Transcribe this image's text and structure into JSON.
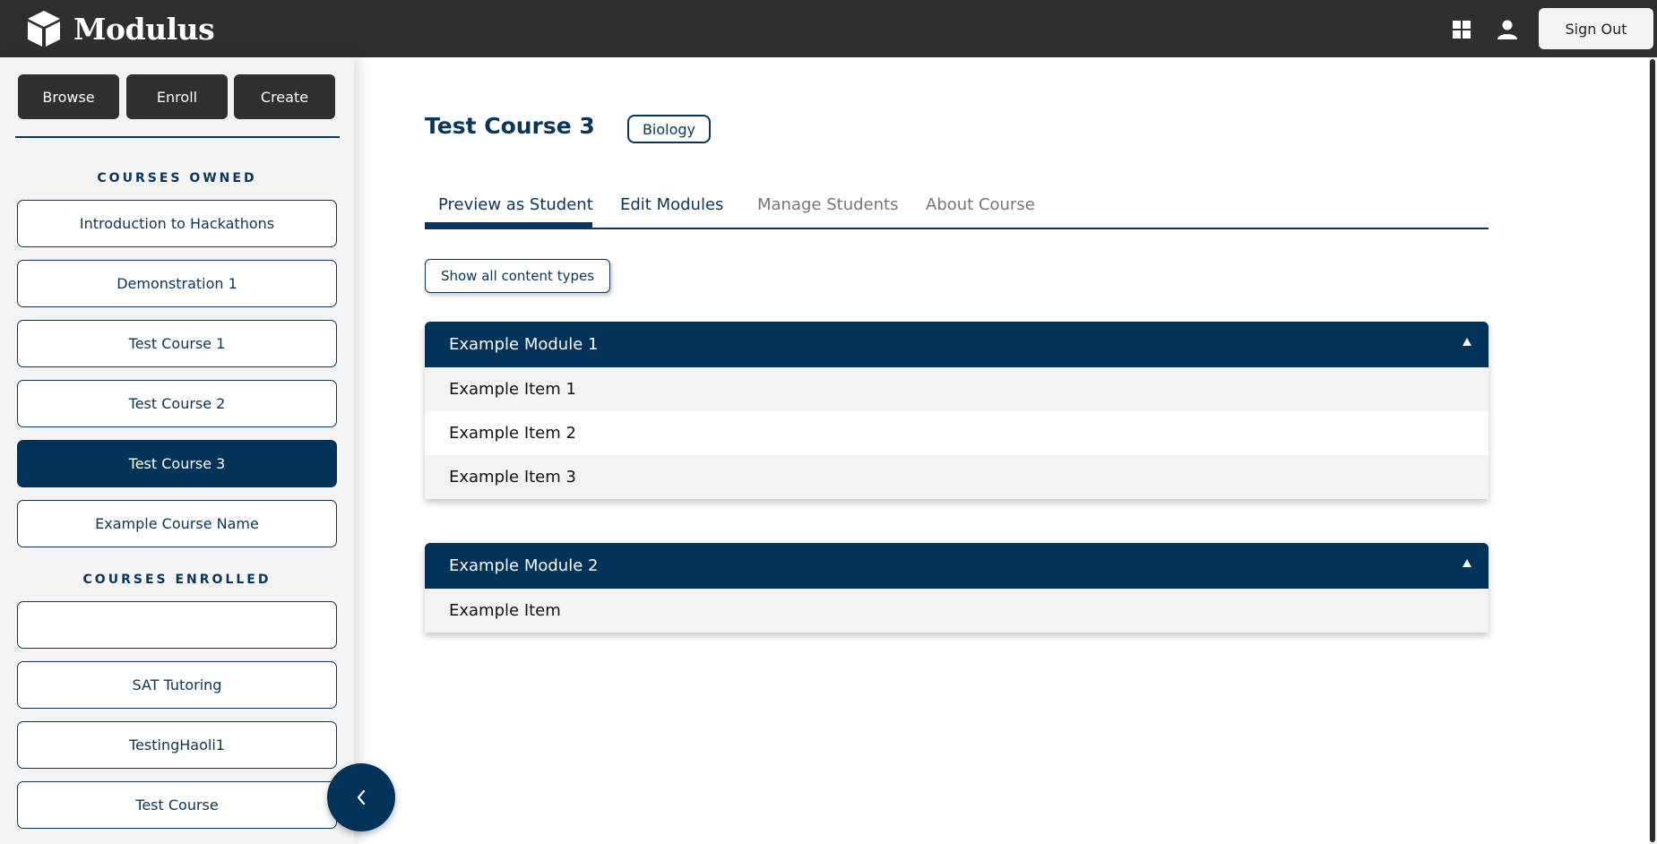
{
  "header": {
    "brand": "Modulus",
    "sign_out_label": "Sign Out"
  },
  "sidebar": {
    "actions": {
      "browse": "Browse",
      "enroll": "Enroll",
      "create": "Create"
    },
    "owned_heading": "COURSES OWNED",
    "owned": [
      {
        "label": "Introduction to Hackathons"
      },
      {
        "label": "Demonstration 1"
      },
      {
        "label": "Test Course 1"
      },
      {
        "label": "Test Course 2"
      },
      {
        "label": "Test Course 3",
        "active": true
      },
      {
        "label": "Example Course Name"
      }
    ],
    "enrolled_heading": "COURSES ENROLLED",
    "enrolled": [
      {
        "label": ""
      },
      {
        "label": "SAT Tutoring"
      },
      {
        "label": "TestingHaoli1"
      },
      {
        "label": "Test Course"
      }
    ]
  },
  "course": {
    "title": "Test Course 3",
    "subject": "Biology",
    "tabs": [
      {
        "label": "Preview as Student",
        "active": true
      },
      {
        "label": "Edit Modules"
      },
      {
        "label": "Manage Students"
      },
      {
        "label": "About Course"
      }
    ],
    "show_types_label": "Show all content types",
    "modules": [
      {
        "title": "Example Module 1",
        "items": [
          "Example Item 1",
          "Example Item 2",
          "Example Item 3"
        ]
      },
      {
        "title": "Example Module 2",
        "items": [
          "Example Item"
        ]
      }
    ]
  },
  "colors": {
    "primary": "#00325a",
    "topbar": "#2f2f2f",
    "sidebar_bg": "#f4f4f4",
    "muted_tab": "#777777"
  },
  "icons": {
    "logo": "cube-logo-icon",
    "apps": "grid-icon",
    "account": "user-icon",
    "collapse": "chevron-left-icon",
    "module_toggle": "caret-up-icon"
  }
}
